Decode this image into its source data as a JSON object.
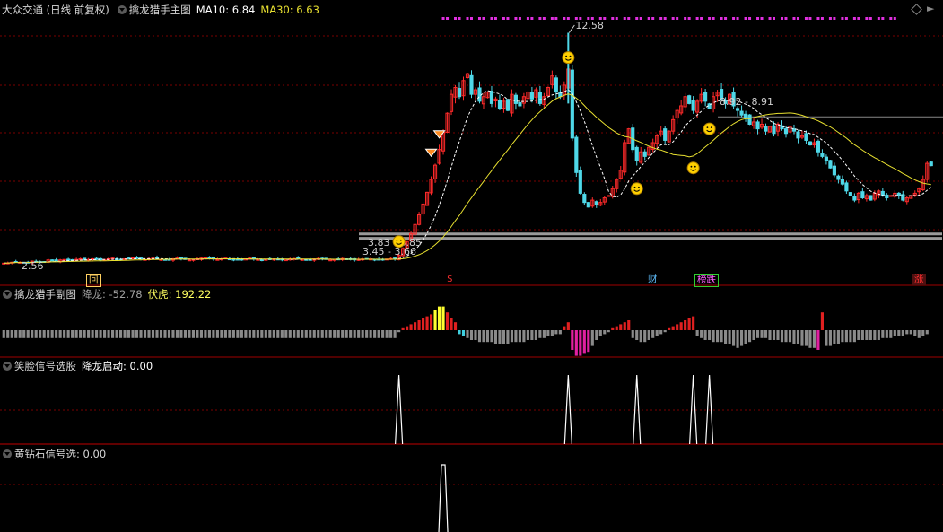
{
  "main": {
    "stock_title": "大众交通 (日线 前复权)",
    "indicator_name": "擒龙猎手主图",
    "ma10_label": "MA10: 6.84",
    "ma30_label": "MA30: 6.63",
    "price_labels": {
      "high": "12.58",
      "low": "2.56",
      "band_upper": "3.83 - 3.85",
      "band_lower": "3.45 - 3.66",
      "resistance": "8.92 - 8.91"
    },
    "event_marks": [
      {
        "label": "回",
        "color": "#ffd060",
        "border": "#ffd060"
      },
      {
        "label": "$",
        "color": "#ff3030",
        "border": ""
      },
      {
        "label": "财",
        "color": "#60c0ff",
        "border": ""
      },
      {
        "label": "榜跌",
        "color": "#ff60ff",
        "border": "#30d030"
      },
      {
        "label": "涨",
        "color": "#ff3030",
        "border": "#a02020"
      }
    ],
    "colors": {
      "up": "#ff2a2a",
      "down": "#4fd8e8",
      "ma10": "#ffffff",
      "ma30": "#e8e030",
      "dots": "#e030e0"
    }
  },
  "sub1": {
    "name": "擒龙猎手副图",
    "label1": "降龙: -52.78",
    "label2": "伏虎: 192.22",
    "colors": {
      "label1": "#a0a0a0",
      "label2": "#ffff60"
    }
  },
  "sub2": {
    "name": "笑脸信号选股",
    "label": "降龙启动: 0.00"
  },
  "sub3": {
    "name": "黄钻石信号选",
    "label": ": 0.00"
  },
  "chart_data": {
    "type": "candlestick",
    "price_axis_range": [
      2.3,
      13.3
    ],
    "ma_values": {
      "MA10": 6.84,
      "MA30": 6.63
    },
    "closes_approx": [
      2.56,
      2.57,
      2.6,
      2.62,
      2.6,
      2.58,
      2.6,
      2.65,
      2.62,
      2.6,
      2.62,
      2.7,
      2.68,
      2.65,
      2.7,
      2.72,
      2.68,
      2.7,
      2.72,
      2.75,
      2.7,
      2.72,
      2.75,
      2.72,
      2.7,
      2.72,
      2.75,
      2.78,
      2.74,
      2.72,
      2.75,
      2.78,
      2.8,
      2.76,
      2.74,
      2.72,
      2.75,
      2.78,
      2.74,
      2.72,
      2.7,
      2.72,
      2.75,
      2.78,
      2.74,
      2.72,
      2.7,
      2.72,
      2.75,
      2.78,
      2.8,
      2.76,
      2.74,
      2.72,
      2.75,
      2.78,
      2.74,
      2.72,
      2.7,
      2.72,
      2.75,
      2.78,
      2.74,
      2.72,
      2.7,
      2.72,
      2.75,
      2.74,
      2.72,
      2.7,
      2.72,
      2.74,
      2.76,
      2.74,
      2.72,
      2.7,
      2.72,
      2.74,
      2.76,
      2.74,
      2.72,
      2.7,
      2.72,
      2.74,
      2.76,
      2.74,
      2.72,
      2.7,
      2.72,
      2.74,
      2.76,
      2.74,
      2.72,
      2.7,
      2.72,
      2.74,
      2.76,
      2.74,
      2.9,
      3.2,
      3.5,
      3.85,
      4.24,
      4.66,
      5.13,
      5.64,
      6.2,
      6.82,
      7.5,
      8.25,
      9.08,
      9.9,
      10.2,
      9.8,
      10.5,
      10.8,
      9.9,
      10.1,
      9.6,
      9.8,
      10.0,
      9.5,
      9.7,
      9.3,
      9.6,
      9.2,
      9.9,
      9.5,
      9.4,
      9.8,
      10.0,
      9.7,
      10.1,
      9.5,
      9.8,
      10.2,
      10.7,
      10.0,
      9.8,
      10.3,
      11.0,
      8.0,
      6.5,
      5.6,
      5.2,
      5.0,
      5.3,
      5.1,
      5.2,
      5.4,
      5.5,
      5.8,
      6.2,
      6.6,
      7.8,
      8.4,
      7.5,
      7.0,
      7.4,
      7.2,
      7.6,
      7.8,
      8.1,
      8.3,
      7.9,
      8.3,
      8.8,
      9.2,
      9.4,
      9.8,
      9.5,
      9.2,
      9.6,
      9.9,
      9.6,
      9.3,
      9.8,
      10.0,
      9.7,
      9.5,
      9.9,
      9.4,
      9.2,
      9.0,
      8.9,
      8.6,
      8.7,
      8.4,
      8.6,
      8.3,
      8.5,
      8.2,
      8.6,
      8.4,
      8.2,
      8.5,
      8.3,
      8.0,
      8.1,
      7.9,
      7.7,
      7.8,
      7.4,
      7.2,
      7.0,
      6.7,
      6.4,
      6.2,
      6.0,
      5.7,
      5.5,
      5.3,
      5.6,
      5.4,
      5.5,
      5.3,
      5.6,
      5.7,
      5.5,
      5.4,
      5.5,
      5.6,
      5.5,
      5.3,
      5.4,
      5.5,
      5.6,
      5.8,
      6.2,
      6.9,
      6.8
    ],
    "sub1_values_approx": [
      -8,
      -8,
      -8,
      -8,
      -8,
      -8,
      -8,
      -8,
      -8,
      -8,
      -8,
      -8,
      -8,
      -8,
      -8,
      -8,
      -8,
      -8,
      -8,
      -8,
      -8,
      -8,
      -8,
      -8,
      -8,
      -8,
      -8,
      -8,
      -8,
      -8,
      -8,
      -8,
      -8,
      -8,
      -8,
      -8,
      -8,
      -8,
      -8,
      -8,
      -8,
      -8,
      -8,
      -8,
      -8,
      -8,
      -8,
      -8,
      -8,
      -8,
      -8,
      -8,
      -8,
      -8,
      -8,
      -8,
      -8,
      -8,
      -8,
      -8,
      -8,
      -8,
      -8,
      -8,
      -8,
      -8,
      -8,
      -8,
      -8,
      -8,
      -8,
      -8,
      -8,
      -8,
      -8,
      -8,
      -8,
      -8,
      -8,
      -8,
      -8,
      -8,
      -8,
      -8,
      -8,
      -8,
      -8,
      -8,
      -8,
      -8,
      -8,
      -8,
      -8,
      -8,
      -8,
      -8,
      -8,
      -8,
      -2,
      2,
      4,
      6,
      8,
      10,
      12,
      14,
      16,
      20,
      24,
      24,
      18,
      12,
      8,
      -4,
      -6,
      -8,
      -10,
      -10,
      -12,
      -12,
      -12,
      -12,
      -14,
      -14,
      -14,
      -14,
      -12,
      -12,
      -12,
      -12,
      -10,
      -10,
      -10,
      -8,
      -8,
      -6,
      -6,
      -4,
      -4,
      4,
      8,
      -20,
      -26,
      -26,
      -24,
      -22,
      -16,
      -10,
      -6,
      -4,
      -2,
      2,
      4,
      6,
      8,
      10,
      -8,
      -10,
      -12,
      -12,
      -10,
      -8,
      -6,
      -4,
      -2,
      2,
      4,
      6,
      8,
      10,
      12,
      14,
      -6,
      -8,
      -10,
      -10,
      -12,
      -12,
      -12,
      -14,
      -14,
      -16,
      -18,
      -16,
      -14,
      -12,
      -10,
      -8,
      -8,
      -8,
      -10,
      -10,
      -10,
      -12,
      -12,
      -12,
      -14,
      -14,
      -16,
      -16,
      -18,
      -18,
      -20,
      18,
      -16,
      -16,
      -14,
      -14,
      -12,
      -12,
      -12,
      -12,
      -10,
      -10,
      -10,
      -10,
      -10,
      -10,
      -8,
      -8,
      -8,
      -6,
      -6,
      -6,
      -4,
      -4,
      -6,
      -8,
      -6,
      -4
    ],
    "smile_signal_count": 5,
    "diamond_signal_count": 1
  }
}
